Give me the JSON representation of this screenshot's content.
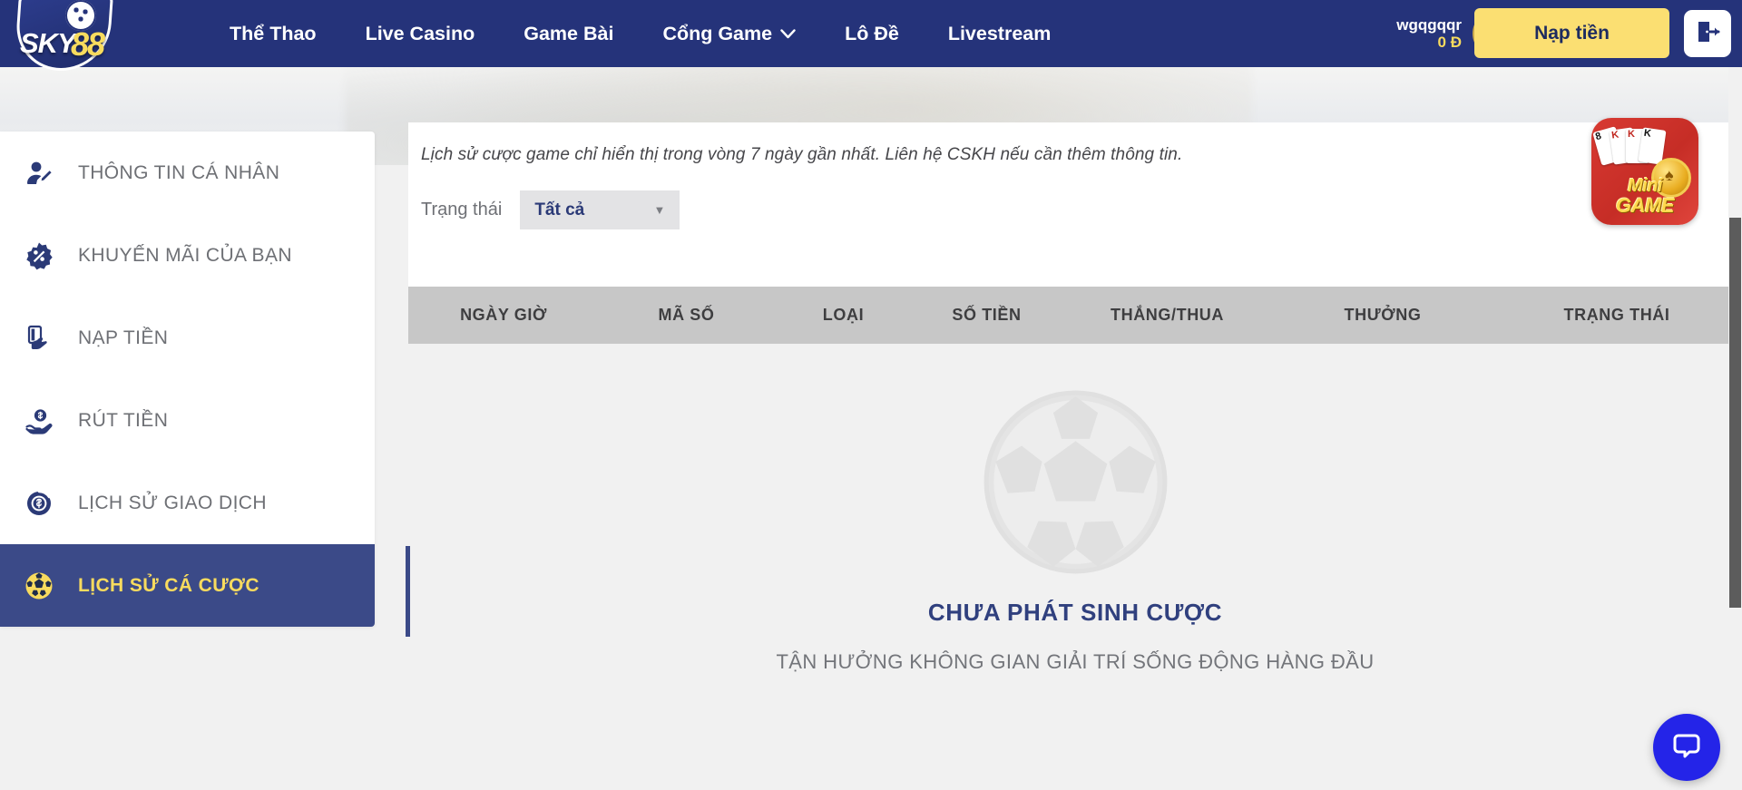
{
  "colors": {
    "navy": "#25337a",
    "navy_active": "#3b4a88",
    "yellow": "#f8db5e",
    "deposit_button": "#fbdf72",
    "table_header": "#c7c7c7",
    "chat_blue": "#2424e8",
    "empty_title": "#30407e"
  },
  "header": {
    "brand": {
      "sky": "SKY",
      "eight": "88"
    },
    "nav": [
      {
        "label": "Thể Thao",
        "has_caret": false
      },
      {
        "label": "Live Casino",
        "has_caret": false
      },
      {
        "label": "Game Bài",
        "has_caret": false
      },
      {
        "label": "Cổng Game",
        "has_caret": true,
        "caret": "⌄"
      },
      {
        "label": "Lô Đề",
        "has_caret": false
      },
      {
        "label": "Livestream",
        "has_caret": false
      }
    ],
    "user": {
      "name": "wgqgqqr",
      "balance": "0 Đ"
    },
    "deposit_label": "Nạp tiền",
    "logout_icon": "logout-icon",
    "avatar_icon": "user-avatar"
  },
  "sidebar": {
    "items": [
      {
        "label": "THÔNG TIN CÁ NHÂN",
        "icon": "user-edit-icon",
        "active": false
      },
      {
        "label": "KHUYẾN MÃI CỦA BẠN",
        "icon": "percent-badge-icon",
        "active": false
      },
      {
        "label": "NẠP TIỀN",
        "icon": "card-hand-icon",
        "active": false
      },
      {
        "label": "RÚT TIỀN",
        "icon": "hand-coin-icon",
        "active": false
      },
      {
        "label": "LỊCH SỬ GIAO DỊCH",
        "icon": "dollar-circle-icon",
        "active": false
      },
      {
        "label": "LỊCH SỬ CÁ CƯỢC",
        "icon": "soccer-ball-icon",
        "active": true
      }
    ]
  },
  "main": {
    "notice": "Lịch sử cược game chỉ hiển thị trong vòng 7 ngày gần nhất. Liên hệ CSKH nếu cần thêm thông tin.",
    "minigame": {
      "line1": "Mini",
      "line2": "GAME",
      "cards": [
        "8",
        "K",
        "K",
        "K"
      ],
      "icon": "minigame-badge"
    },
    "filter": {
      "label": "Trạng thái",
      "value": "Tất cả",
      "arrow": "▼",
      "options": [
        "Tất cả"
      ]
    },
    "table": {
      "columns": [
        "NGÀY GIỜ",
        "MÃ SỐ",
        "LOẠI",
        "SỐ TIỀN",
        "THẮNG/THUA",
        "THƯỞNG",
        "TRẠNG THÁI"
      ],
      "rows": []
    },
    "empty_state": {
      "icon": "soccer-ball-watermark",
      "title": "CHƯA PHÁT SINH CƯỢC",
      "subtitle": "TẬN HƯỞNG KHÔNG GIAN GIẢI TRÍ SỐNG ĐỘNG HÀNG ĐẦU"
    }
  },
  "chat": {
    "icon": "chat-bubble-icon"
  }
}
